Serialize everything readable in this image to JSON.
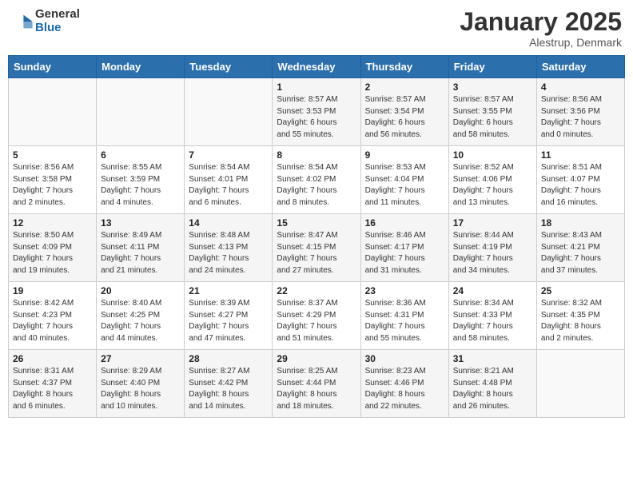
{
  "header": {
    "logo_general": "General",
    "logo_blue": "Blue",
    "month_title": "January 2025",
    "location": "Alestrup, Denmark"
  },
  "days_of_week": [
    "Sunday",
    "Monday",
    "Tuesday",
    "Wednesday",
    "Thursday",
    "Friday",
    "Saturday"
  ],
  "weeks": [
    [
      {
        "day": "",
        "info": ""
      },
      {
        "day": "",
        "info": ""
      },
      {
        "day": "",
        "info": ""
      },
      {
        "day": "1",
        "info": "Sunrise: 8:57 AM\nSunset: 3:53 PM\nDaylight: 6 hours\nand 55 minutes."
      },
      {
        "day": "2",
        "info": "Sunrise: 8:57 AM\nSunset: 3:54 PM\nDaylight: 6 hours\nand 56 minutes."
      },
      {
        "day": "3",
        "info": "Sunrise: 8:57 AM\nSunset: 3:55 PM\nDaylight: 6 hours\nand 58 minutes."
      },
      {
        "day": "4",
        "info": "Sunrise: 8:56 AM\nSunset: 3:56 PM\nDaylight: 7 hours\nand 0 minutes."
      }
    ],
    [
      {
        "day": "5",
        "info": "Sunrise: 8:56 AM\nSunset: 3:58 PM\nDaylight: 7 hours\nand 2 minutes."
      },
      {
        "day": "6",
        "info": "Sunrise: 8:55 AM\nSunset: 3:59 PM\nDaylight: 7 hours\nand 4 minutes."
      },
      {
        "day": "7",
        "info": "Sunrise: 8:54 AM\nSunset: 4:01 PM\nDaylight: 7 hours\nand 6 minutes."
      },
      {
        "day": "8",
        "info": "Sunrise: 8:54 AM\nSunset: 4:02 PM\nDaylight: 7 hours\nand 8 minutes."
      },
      {
        "day": "9",
        "info": "Sunrise: 8:53 AM\nSunset: 4:04 PM\nDaylight: 7 hours\nand 11 minutes."
      },
      {
        "day": "10",
        "info": "Sunrise: 8:52 AM\nSunset: 4:06 PM\nDaylight: 7 hours\nand 13 minutes."
      },
      {
        "day": "11",
        "info": "Sunrise: 8:51 AM\nSunset: 4:07 PM\nDaylight: 7 hours\nand 16 minutes."
      }
    ],
    [
      {
        "day": "12",
        "info": "Sunrise: 8:50 AM\nSunset: 4:09 PM\nDaylight: 7 hours\nand 19 minutes."
      },
      {
        "day": "13",
        "info": "Sunrise: 8:49 AM\nSunset: 4:11 PM\nDaylight: 7 hours\nand 21 minutes."
      },
      {
        "day": "14",
        "info": "Sunrise: 8:48 AM\nSunset: 4:13 PM\nDaylight: 7 hours\nand 24 minutes."
      },
      {
        "day": "15",
        "info": "Sunrise: 8:47 AM\nSunset: 4:15 PM\nDaylight: 7 hours\nand 27 minutes."
      },
      {
        "day": "16",
        "info": "Sunrise: 8:46 AM\nSunset: 4:17 PM\nDaylight: 7 hours\nand 31 minutes."
      },
      {
        "day": "17",
        "info": "Sunrise: 8:44 AM\nSunset: 4:19 PM\nDaylight: 7 hours\nand 34 minutes."
      },
      {
        "day": "18",
        "info": "Sunrise: 8:43 AM\nSunset: 4:21 PM\nDaylight: 7 hours\nand 37 minutes."
      }
    ],
    [
      {
        "day": "19",
        "info": "Sunrise: 8:42 AM\nSunset: 4:23 PM\nDaylight: 7 hours\nand 40 minutes."
      },
      {
        "day": "20",
        "info": "Sunrise: 8:40 AM\nSunset: 4:25 PM\nDaylight: 7 hours\nand 44 minutes."
      },
      {
        "day": "21",
        "info": "Sunrise: 8:39 AM\nSunset: 4:27 PM\nDaylight: 7 hours\nand 47 minutes."
      },
      {
        "day": "22",
        "info": "Sunrise: 8:37 AM\nSunset: 4:29 PM\nDaylight: 7 hours\nand 51 minutes."
      },
      {
        "day": "23",
        "info": "Sunrise: 8:36 AM\nSunset: 4:31 PM\nDaylight: 7 hours\nand 55 minutes."
      },
      {
        "day": "24",
        "info": "Sunrise: 8:34 AM\nSunset: 4:33 PM\nDaylight: 7 hours\nand 58 minutes."
      },
      {
        "day": "25",
        "info": "Sunrise: 8:32 AM\nSunset: 4:35 PM\nDaylight: 8 hours\nand 2 minutes."
      }
    ],
    [
      {
        "day": "26",
        "info": "Sunrise: 8:31 AM\nSunset: 4:37 PM\nDaylight: 8 hours\nand 6 minutes."
      },
      {
        "day": "27",
        "info": "Sunrise: 8:29 AM\nSunset: 4:40 PM\nDaylight: 8 hours\nand 10 minutes."
      },
      {
        "day": "28",
        "info": "Sunrise: 8:27 AM\nSunset: 4:42 PM\nDaylight: 8 hours\nand 14 minutes."
      },
      {
        "day": "29",
        "info": "Sunrise: 8:25 AM\nSunset: 4:44 PM\nDaylight: 8 hours\nand 18 minutes."
      },
      {
        "day": "30",
        "info": "Sunrise: 8:23 AM\nSunset: 4:46 PM\nDaylight: 8 hours\nand 22 minutes."
      },
      {
        "day": "31",
        "info": "Sunrise: 8:21 AM\nSunset: 4:48 PM\nDaylight: 8 hours\nand 26 minutes."
      },
      {
        "day": "",
        "info": ""
      }
    ]
  ]
}
